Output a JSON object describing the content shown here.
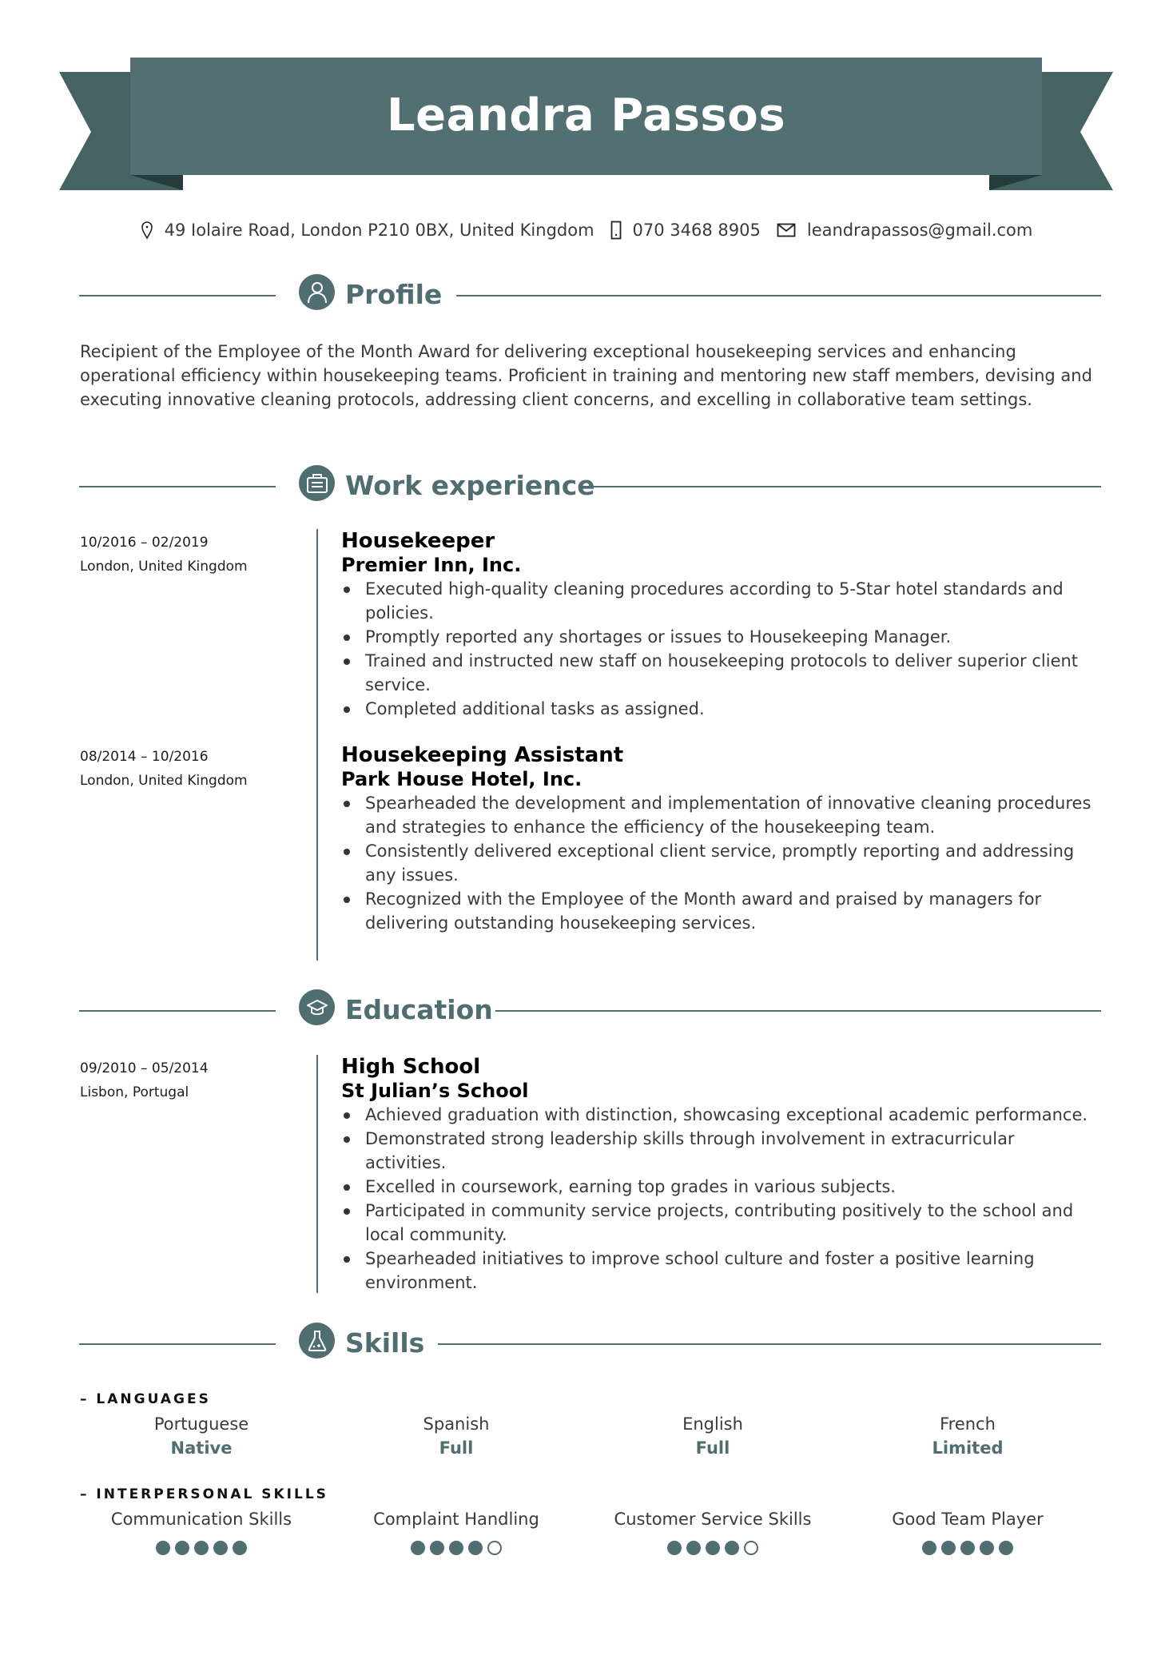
{
  "header": {
    "name": "Leandra Passos",
    "colors": {
      "banner": "#526f72",
      "tails": "#456363",
      "fold": "#263b3c",
      "accent": "#506e71"
    }
  },
  "contact": {
    "address": {
      "icon": "map-pin-icon",
      "text": "49 Iolaire Road, London P210 0BX, United Kingdom"
    },
    "phone": {
      "icon": "phone-icon",
      "text": "070 3468 8905"
    },
    "email": {
      "icon": "mail-icon",
      "text": "leandrapassos@gmail.com"
    }
  },
  "sections": {
    "profile": {
      "title": "Profile",
      "icon": "user-icon"
    },
    "work": {
      "title": "Work experience",
      "icon": "briefcase-icon"
    },
    "education": {
      "title": "Education",
      "icon": "graduation-cap-icon"
    },
    "skills": {
      "title": "Skills",
      "icon": "flask-icon"
    }
  },
  "profile": {
    "lines": [
      "Recipient of the Employee of the Month Award for delivering exceptional housekeeping services and enhancing",
      "operational efficiency within housekeeping teams. Proficient in training and mentoring new staff members, devising and",
      "executing innovative cleaning protocols, addressing client concerns, and excelling in collaborative team settings."
    ]
  },
  "work": [
    {
      "dates": "10/2016 – 02/2019",
      "location": "London, United Kingdom",
      "title": "Housekeeper",
      "company": "Premier Inn, Inc.",
      "bullets": [
        "Executed high-quality cleaning procedures according to 5-Star hotel standards and policies.",
        "Promptly reported any shortages or issues to Housekeeping Manager.",
        "Trained and instructed new staff on housekeeping protocols to deliver superior client service.",
        "Completed additional tasks as assigned."
      ]
    },
    {
      "dates": "08/2014 – 10/2016",
      "location": "London, United Kingdom",
      "title": "Housekeeping Assistant",
      "company": "Park House Hotel, Inc.",
      "bullets": [
        "Spearheaded the development and implementation of innovative cleaning procedures and strategies to enhance the efficiency of the housekeeping team.",
        "Consistently delivered exceptional client service, promptly reporting and addressing any issues.",
        "Recognized with the Employee of the Month award and praised by managers for delivering outstanding housekeeping services."
      ]
    }
  ],
  "education": [
    {
      "dates": "09/2010 – 05/2014",
      "location": "Lisbon, Portugal",
      "title": "High School",
      "school": "St Julian’s School",
      "bullets": [
        "Achieved graduation with distinction, showcasing exceptional academic performance.",
        "Demonstrated strong leadership skills through involvement in extracurricular activities.",
        "Excelled in coursework, earning top grades in various subjects.",
        "Participated in community service projects, contributing positively to the school and local community.",
        "Spearheaded initiatives to improve school culture and foster a positive learning environment."
      ]
    }
  ],
  "skills": {
    "languages_label": "– LANGUAGES",
    "languages": [
      {
        "name": "Portuguese",
        "level": "Native"
      },
      {
        "name": "Spanish",
        "level": "Full"
      },
      {
        "name": "English",
        "level": "Full"
      },
      {
        "name": "French",
        "level": "Limited"
      }
    ],
    "interpersonal_label": "– INTERPERSONAL SKILLS",
    "interpersonal": [
      {
        "name": "Communication Skills",
        "rating": 5,
        "max": 5
      },
      {
        "name": "Complaint Handling",
        "rating": 4,
        "max": 5
      },
      {
        "name": "Customer Service Skills",
        "rating": 4,
        "max": 5
      },
      {
        "name": "Good Team Player",
        "rating": 5,
        "max": 5
      }
    ]
  }
}
